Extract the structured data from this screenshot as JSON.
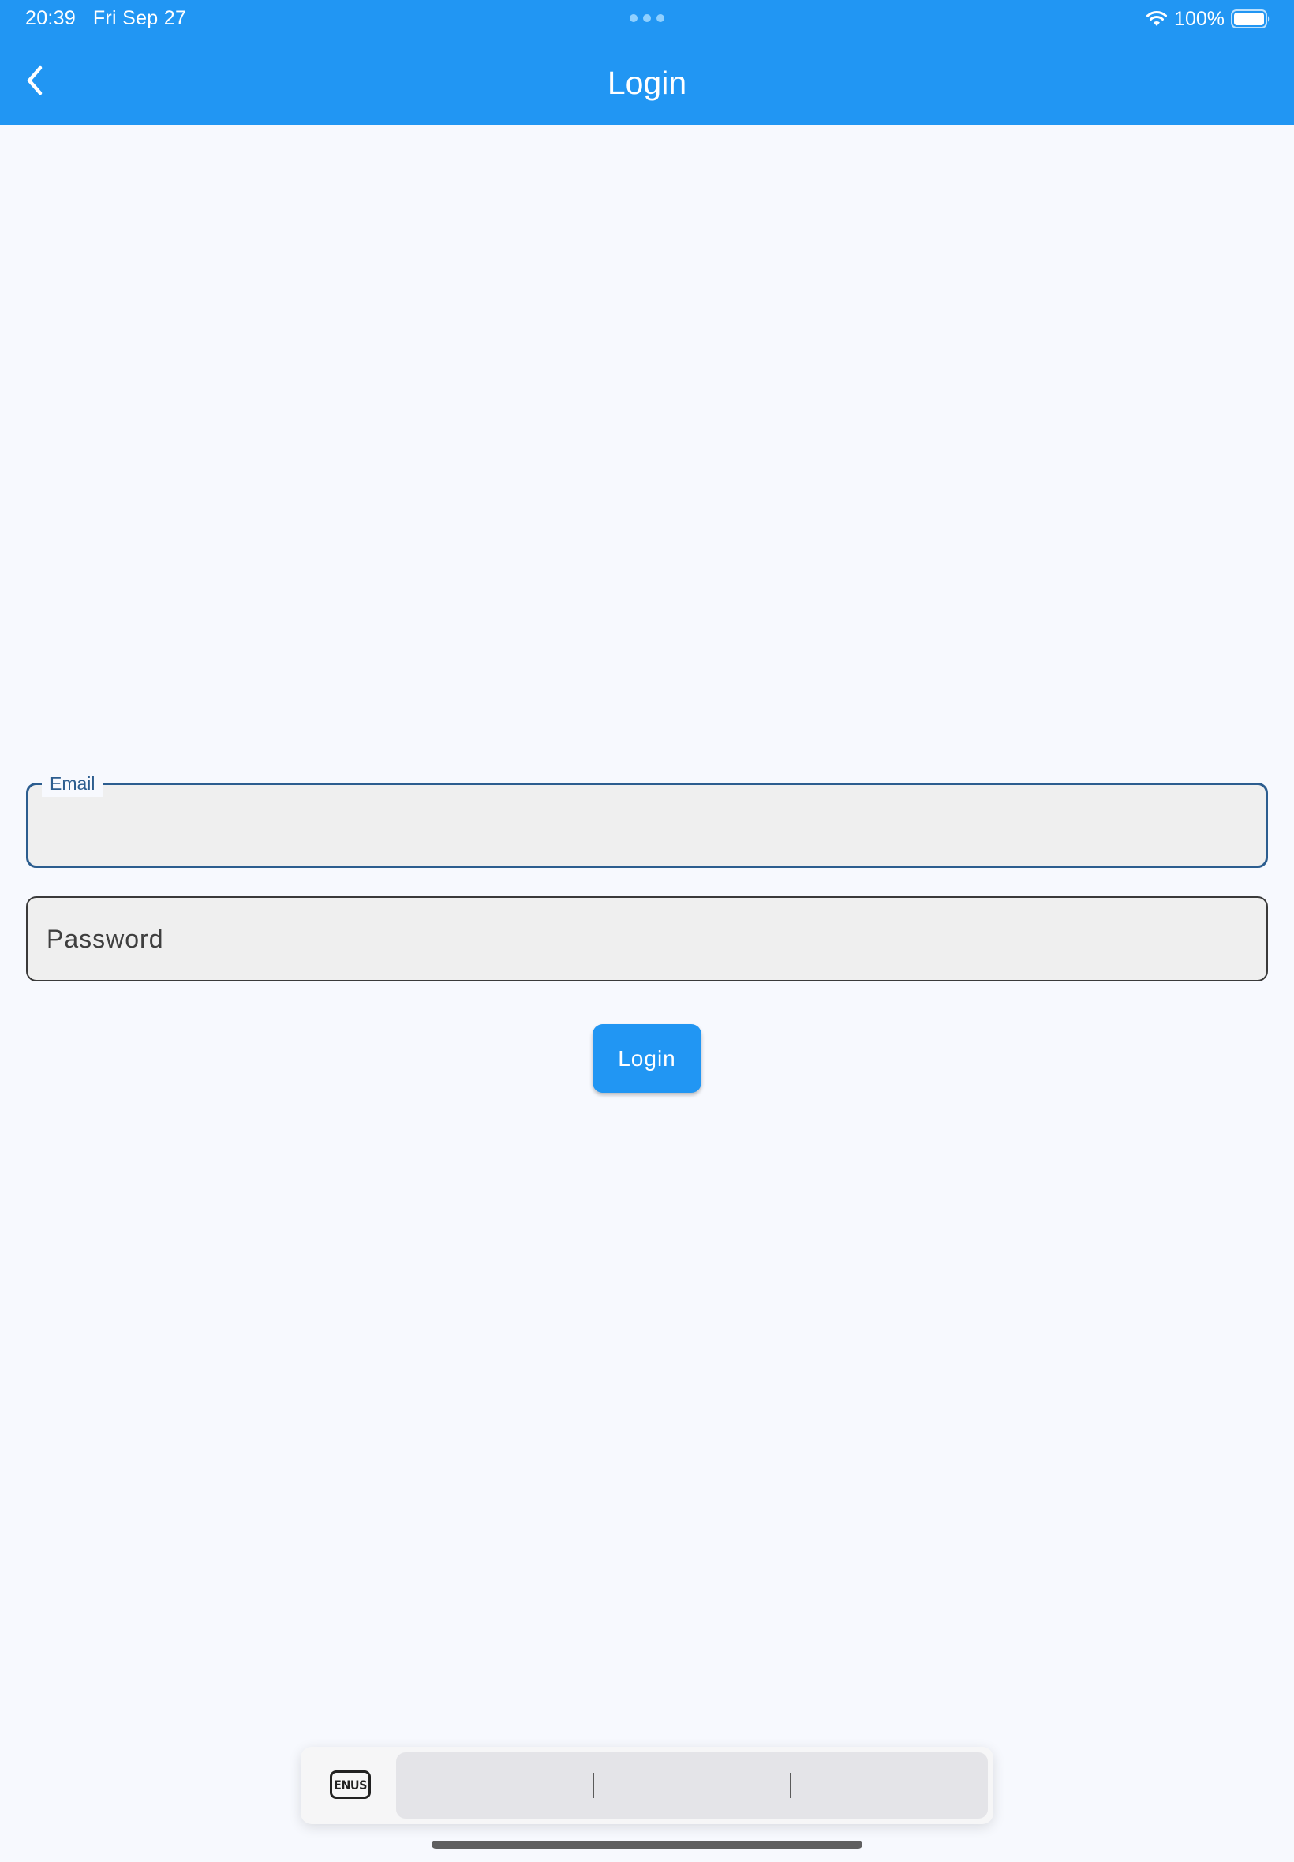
{
  "status_bar": {
    "time": "20:39",
    "date": "Fri Sep 27",
    "battery": "100%"
  },
  "app_bar": {
    "title": "Login"
  },
  "form": {
    "email": {
      "label": "Email",
      "value": ""
    },
    "password": {
      "label": "Password",
      "value": ""
    },
    "submit_label": "Login"
  },
  "keyboard_bar": {
    "language": "ENUS",
    "suggestions": [
      "",
      "",
      ""
    ]
  },
  "colors": {
    "primary": "#2196f3",
    "focus_outline": "#2c5d8f",
    "background": "#f7f9fe",
    "field_fill": "#efefef"
  }
}
